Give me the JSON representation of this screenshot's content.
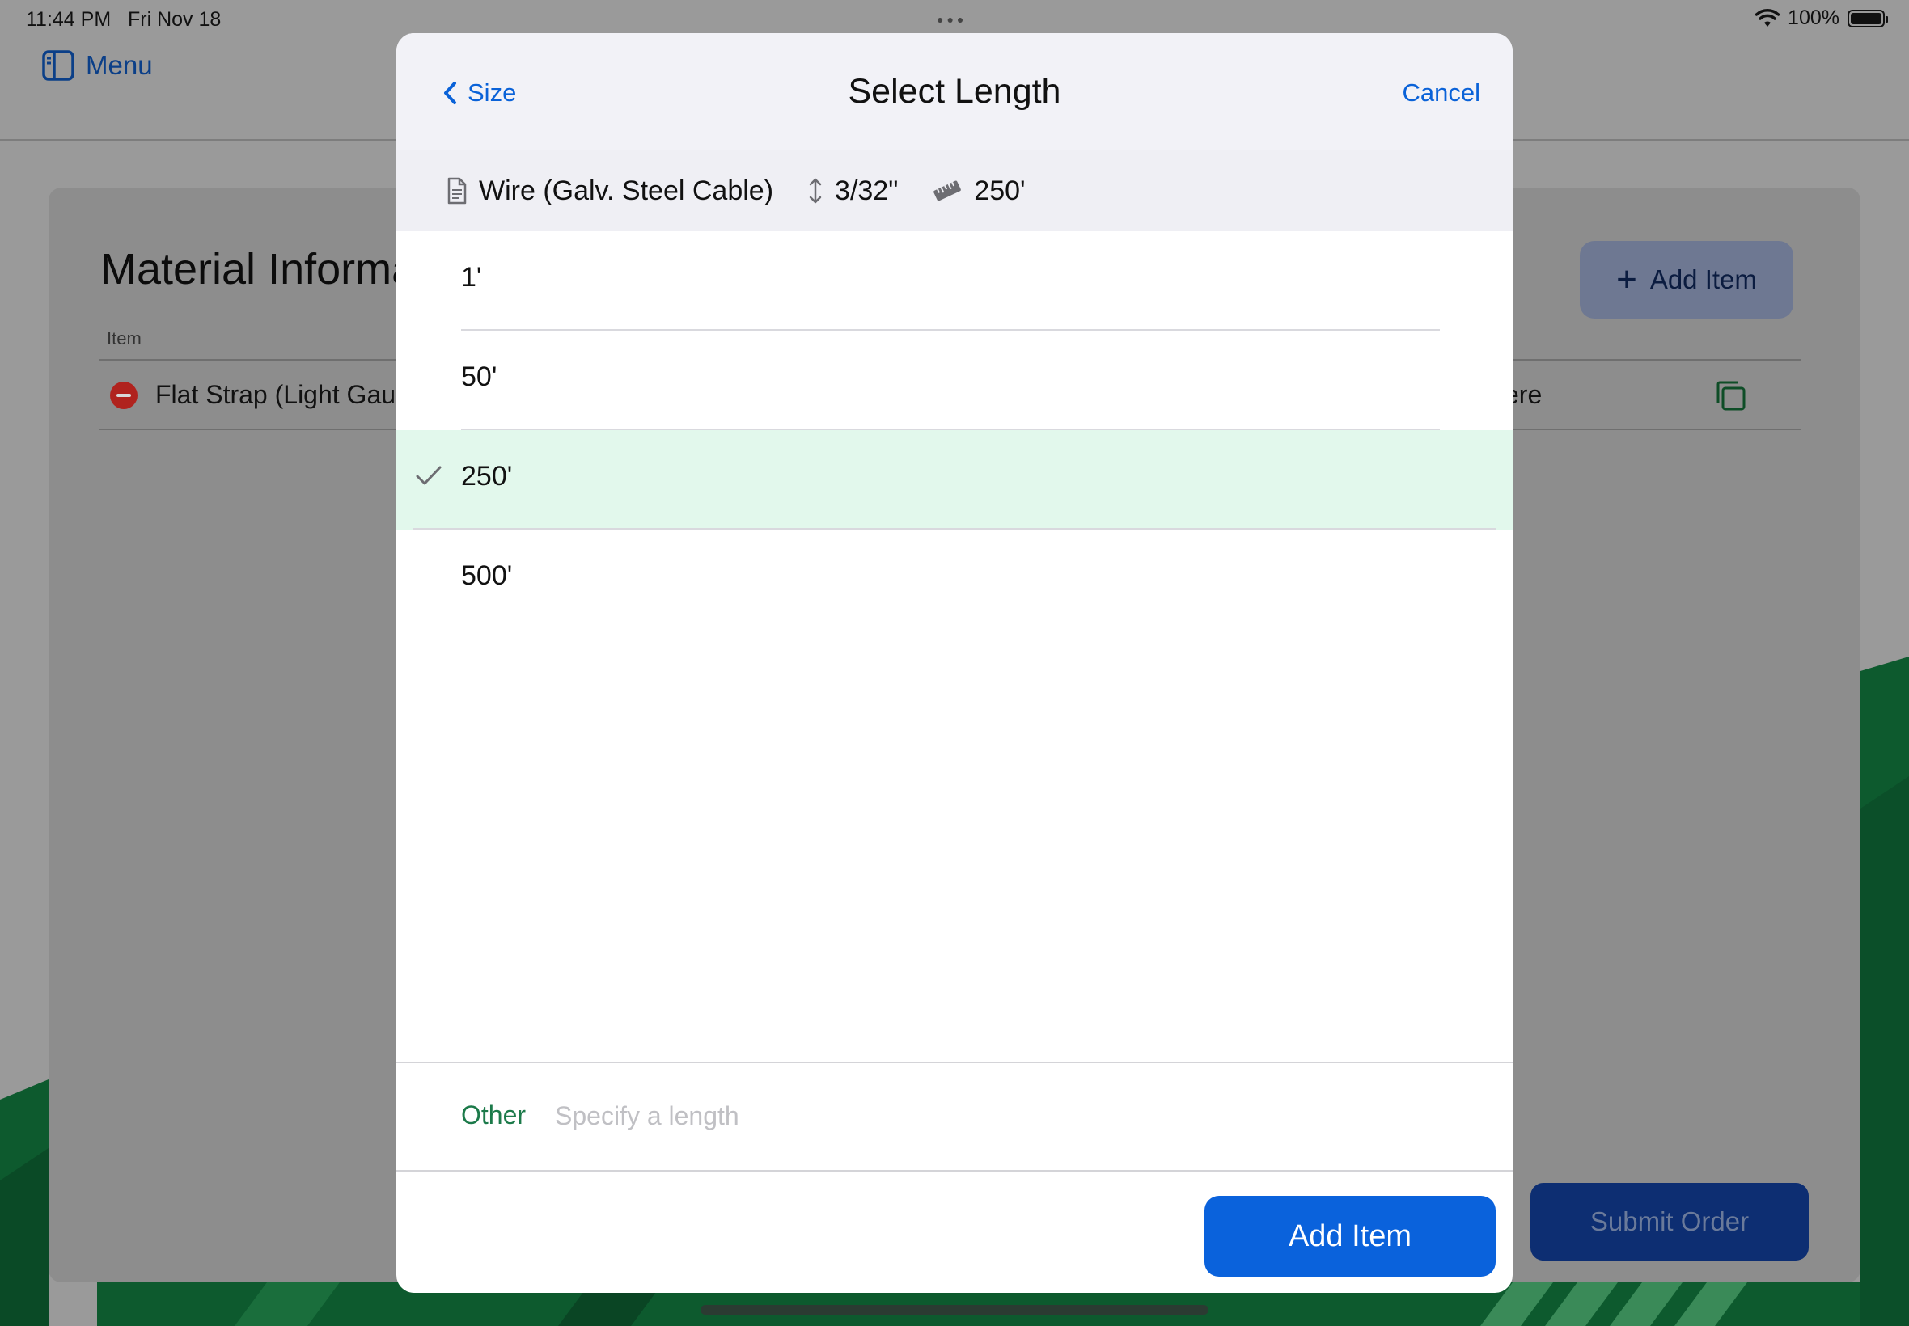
{
  "status_bar": {
    "time": "11:44 PM",
    "date": "Fri Nov 18",
    "battery": "100%"
  },
  "app_header": {
    "menu_label": "Menu"
  },
  "background_card": {
    "title": "Material Informa",
    "column_item": "Item",
    "row_text": "Flat Strap (Light Gau",
    "row_right_text": "ere",
    "add_item_label": "Add Item",
    "submit_label": "Submit Order"
  },
  "modal": {
    "back_label": "Size",
    "title": "Select Length",
    "cancel_label": "Cancel",
    "summary": {
      "material": "Wire (Galv. Steel Cable)",
      "size": "3/32\"",
      "length": "250'"
    },
    "options": [
      {
        "label": "1'",
        "selected": false
      },
      {
        "label": "50'",
        "selected": false
      },
      {
        "label": "250'",
        "selected": true
      },
      {
        "label": "500'",
        "selected": false
      }
    ],
    "other_label": "Other",
    "other_placeholder": "Specify a length",
    "add_item_label": "Add Item"
  },
  "colors": {
    "accent_blue": "#0a62dc",
    "selected_row": "#e2f8ec",
    "other_green": "#1c7a4a",
    "delete_red": "#b0231e"
  }
}
